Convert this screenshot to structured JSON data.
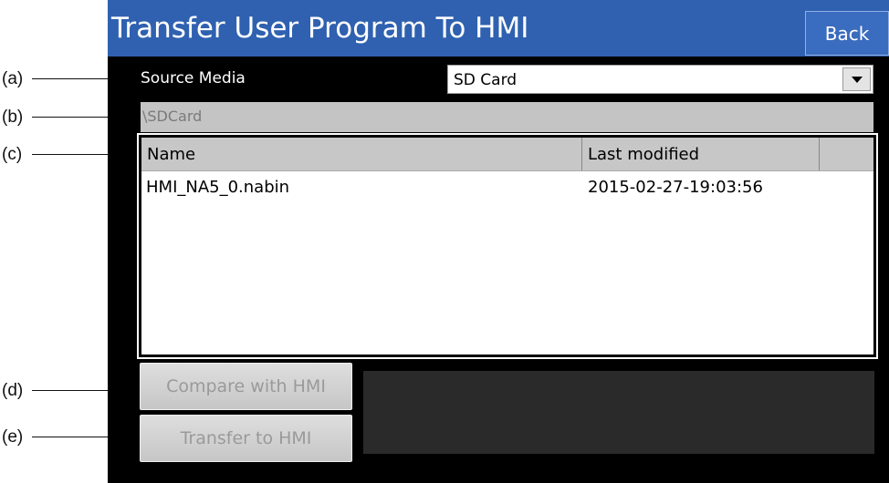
{
  "callouts": [
    "(a)",
    "(b)",
    "(c)",
    "(d)",
    "(e)"
  ],
  "window": {
    "title": "Transfer User Program To HMI",
    "back_label": "Back"
  },
  "source": {
    "label": "Source Media",
    "selected": "SD Card"
  },
  "path": "\\SDCard",
  "file_list": {
    "columns": [
      "Name",
      "Last modified",
      ""
    ],
    "rows": [
      {
        "name": "HMI_NA5_0.nabin",
        "modified": "2015-02-27-19:03:56"
      }
    ]
  },
  "actions": {
    "compare_label": "Compare with HMI",
    "transfer_label": "Transfer to HMI"
  },
  "colors": {
    "title_bar": "#2f61b0",
    "background": "#000000",
    "disabled_button": "#d2d2d2"
  }
}
